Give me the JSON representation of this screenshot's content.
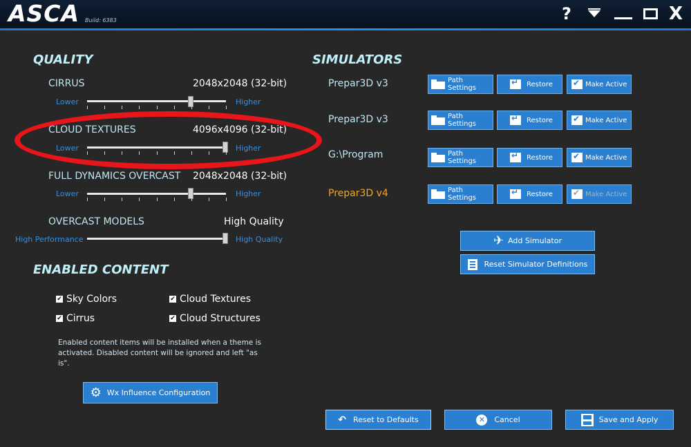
{
  "app": {
    "title": "ASCA",
    "build": "Build: 6383"
  },
  "window_controls": {
    "help": "?",
    "close": "X"
  },
  "quality": {
    "heading": "QUALITY",
    "sliders": [
      {
        "label": "CIRRUS",
        "value": "2048x2048 (32-bit)",
        "low": "Lower",
        "high": "Higher",
        "level": 0.75
      },
      {
        "label": "CLOUD TEXTURES",
        "value": "4096x4096 (32-bit)",
        "low": "Lower",
        "high": "Higher",
        "level": 1.0
      },
      {
        "label": "FULL DYNAMICS OVERCAST",
        "value": "2048x2048 (32-bit)",
        "low": "Lower",
        "high": "Higher",
        "level": 0.75
      },
      {
        "label": "OVERCAST MODELS",
        "value": "High Quality",
        "low": "High Performance",
        "high": "High Quality",
        "level": 1.0
      }
    ]
  },
  "content": {
    "heading": "ENABLED CONTENT",
    "items": [
      {
        "label": "Sky Colors",
        "checked": true
      },
      {
        "label": "Cloud Textures",
        "checked": true
      },
      {
        "label": "Cirrus",
        "checked": true
      },
      {
        "label": "Cloud Structures",
        "checked": true
      }
    ],
    "note": "Enabled content items will be installed when a theme is activated.  Disabled content will be ignored and left \"as is\".",
    "wx_button": "Wx Influence Configuration"
  },
  "simulators": {
    "heading": "SIMULATORS",
    "path_label": "Path Settings",
    "restore_label": "Restore",
    "make_active_label": "Make Active",
    "list": [
      {
        "name": "Prepar3D v3",
        "active": false
      },
      {
        "name": "Prepar3D v3",
        "active": false
      },
      {
        "name": "G:\\Program",
        "active": false
      },
      {
        "name": "Prepar3D v4",
        "active": true
      }
    ],
    "add_button": "Add Simulator",
    "reset_defs_button": "Reset Simulator Definitions"
  },
  "footer": {
    "reset_defaults": "Reset to Defaults",
    "cancel": "Cancel",
    "save_apply": "Save and Apply"
  },
  "colors": {
    "accent": "#2a7fd0",
    "active_sim": "#f5a623",
    "highlight": "#e8151b"
  }
}
